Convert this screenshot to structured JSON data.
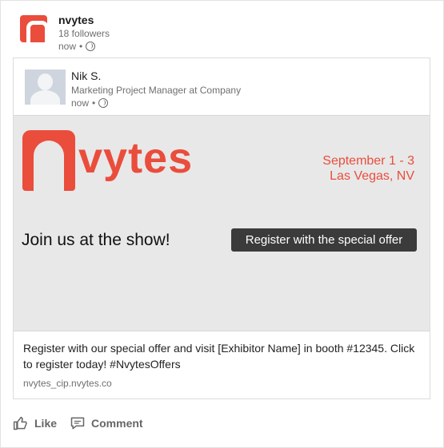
{
  "post": {
    "org_name": "nvytes",
    "followers": "18 followers",
    "time": "now",
    "separator": "•"
  },
  "shared": {
    "author_name": "Nik S.",
    "author_title": "Marketing Project Manager at Company",
    "time": "now",
    "separator": "•",
    "banner": {
      "brand_text": "vytes",
      "date_line": "September 1 - 3",
      "location_line": "Las Vegas, NV",
      "join_text": "Join us at the show!",
      "register_label": "Register with the special offer"
    },
    "body": "Register with our special offer and visit [Exhibitor Name] in booth #12345. Click to register today! #NvytesOffers",
    "link": "nvytes_cip.nvytes.co"
  },
  "actions": {
    "like_label": "Like",
    "comment_label": "Comment"
  },
  "colors": {
    "brand": "#ea4d3c",
    "button": "#3b3b3b",
    "muted": "#6f6f6f"
  },
  "icons": [
    "nvytes-logo",
    "globe-icon",
    "default-avatar",
    "thumbs-up-icon",
    "comment-icon"
  ]
}
